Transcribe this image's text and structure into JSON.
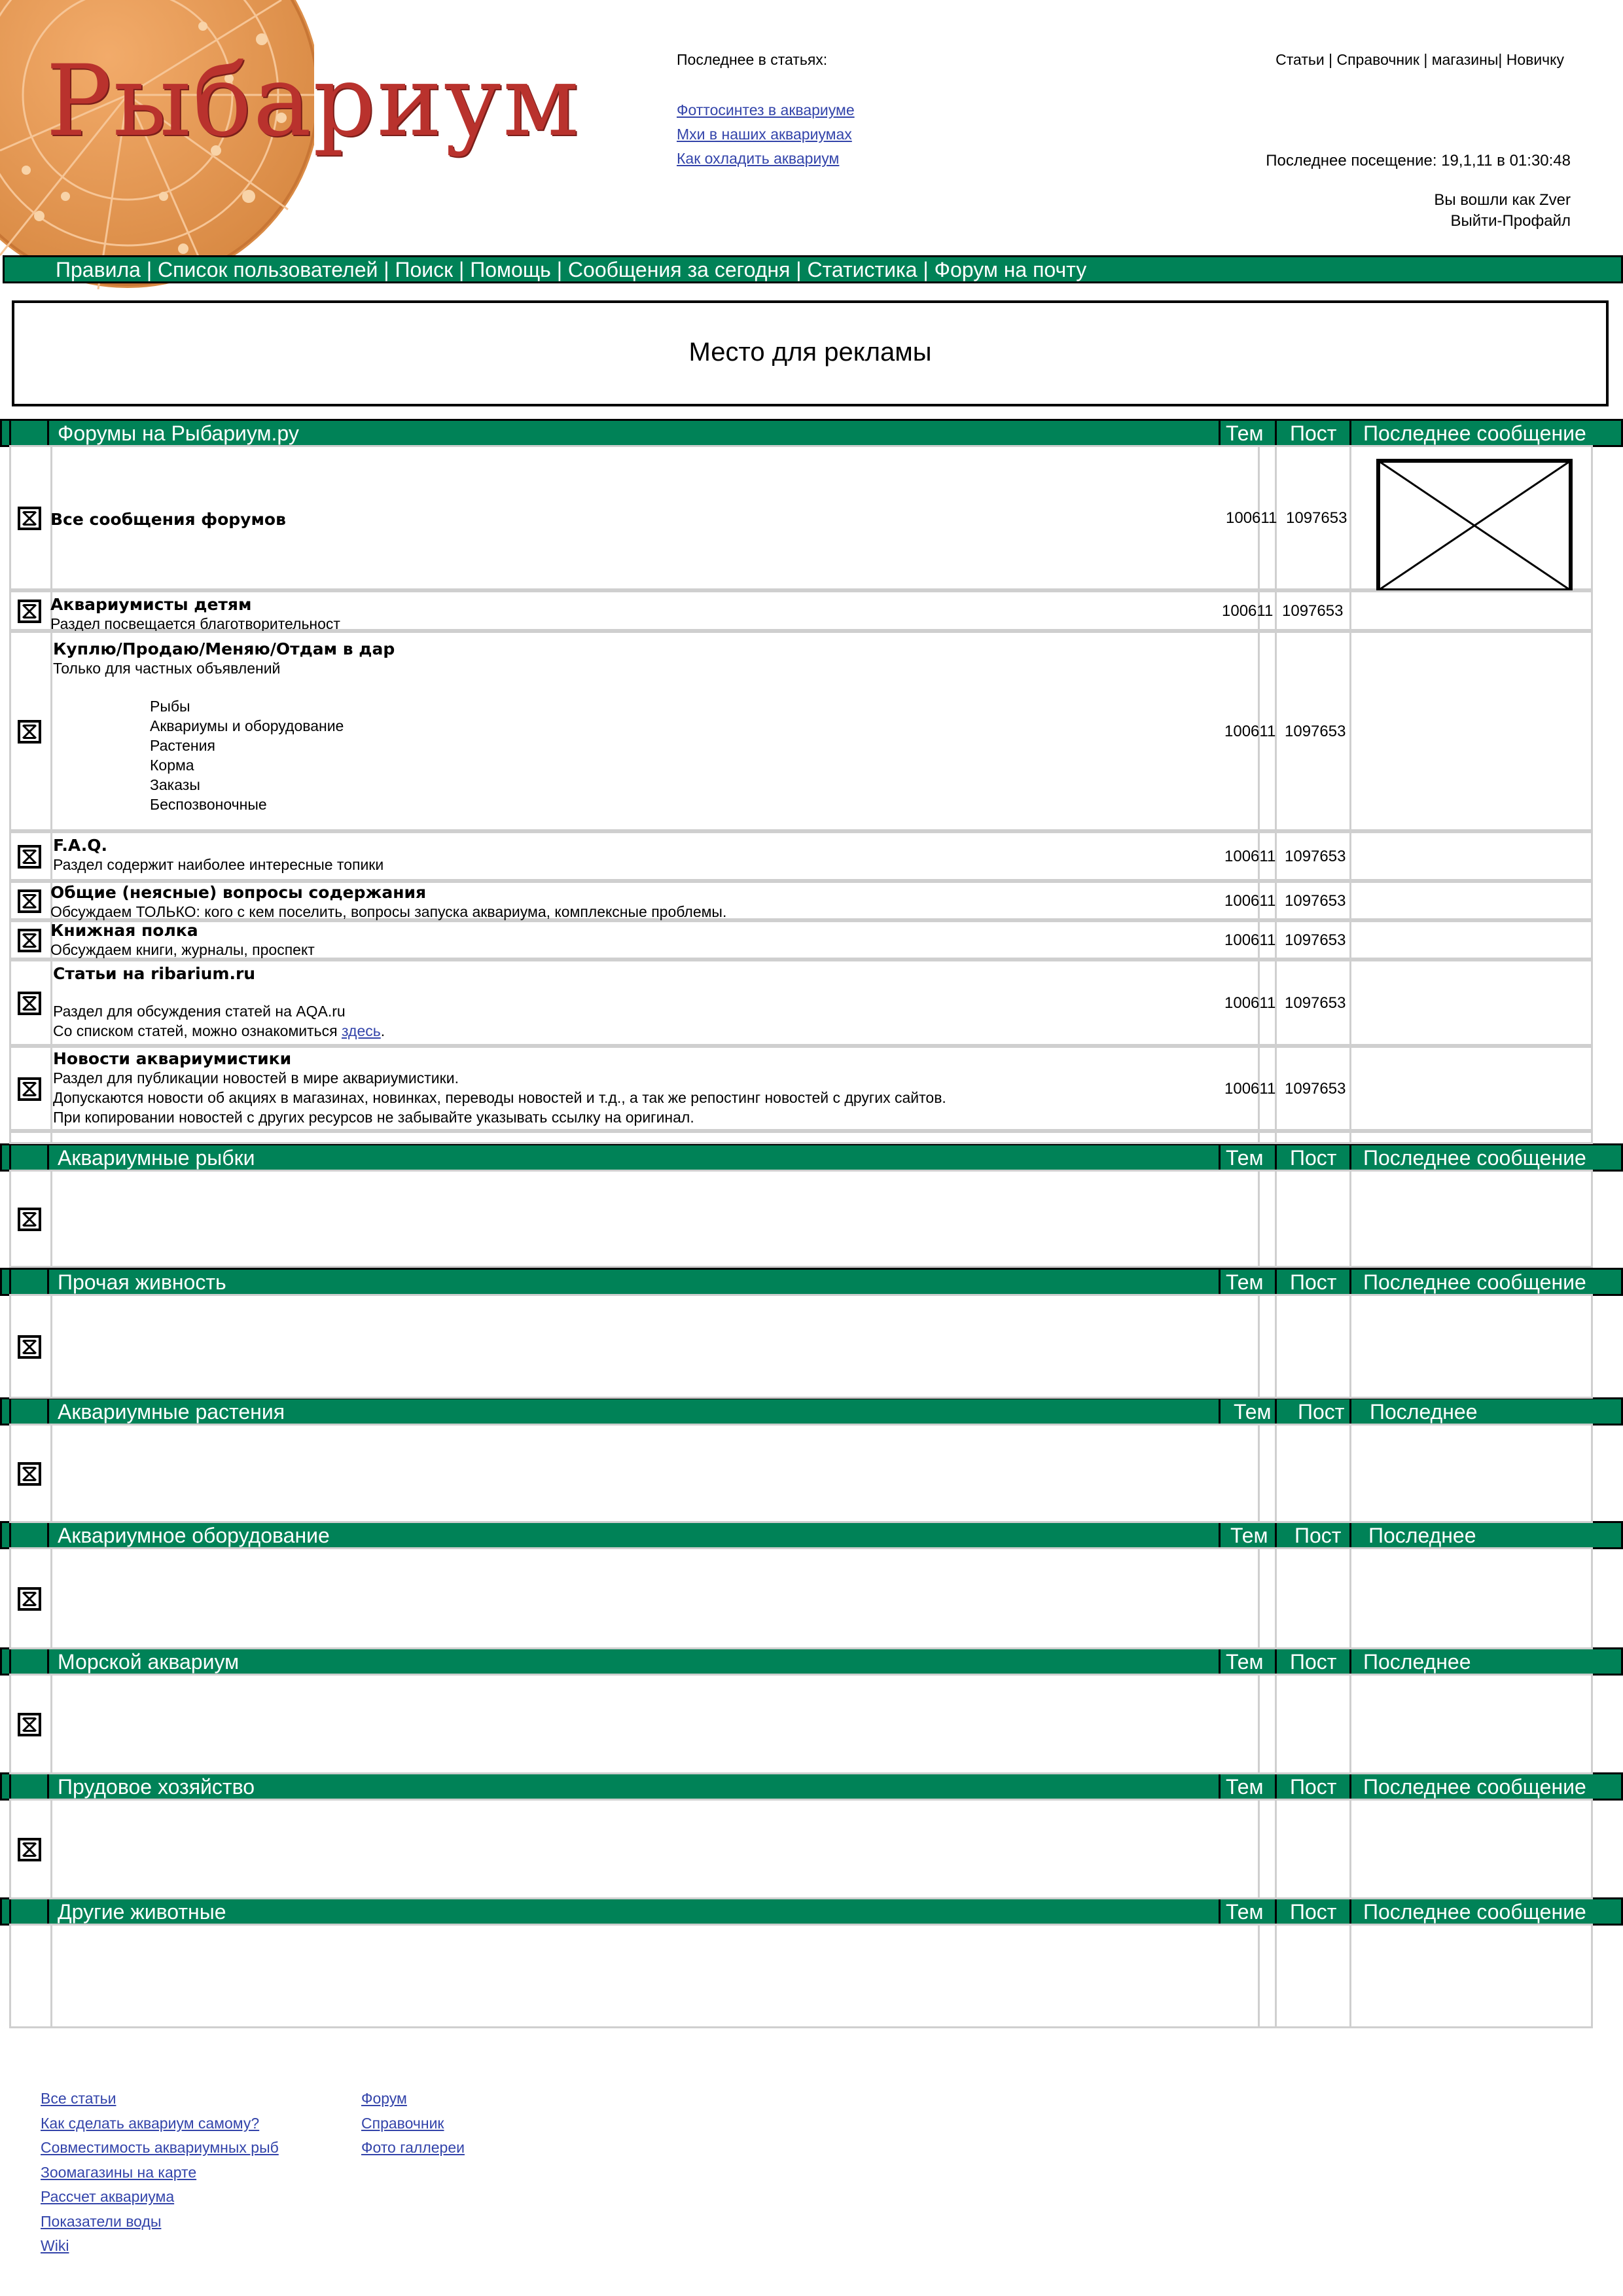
{
  "header": {
    "logo_text": "Рыбариум",
    "latest_heading": "Последнее в статьях:",
    "latest_articles": [
      "Фоттосинтез в аквариуме",
      "Мхи в наших аквариумах",
      "Как охладить аквариум"
    ],
    "top_nav": "Статьи | Справочник | магазины| Новичку",
    "last_visit": "Последнее посещение: 19,1,11 в 01:30:48",
    "logged_as": "Вы вошли как Zver",
    "logout_profile": "Выйти-Профайл"
  },
  "main_nav": "Правила | Список пользователей | Поиск | Помощь | Сообщения за сегодня | Статистика | Форум на почту",
  "ad_text": "Место для рекламы",
  "colors": {
    "bar_green": "#008257",
    "link": "#3344aa",
    "row_border": "#cfcfcf"
  },
  "sections": [
    {
      "title": "Форумы на Рыбариум.ру",
      "col_topics": "Тем",
      "col_posts": "Пост",
      "col_last": "Последнее сообщение"
    },
    {
      "title": "Аквариумные рыбки",
      "col_topics": "Тем",
      "col_posts": "Пост",
      "col_last": "Последнее сообщение"
    },
    {
      "title": "Прочая живность",
      "col_topics": "Тем",
      "col_posts": "Пост",
      "col_last": "Последнее сообщение"
    },
    {
      "title": "Аквариумные растения",
      "col_topics": "Тем",
      "col_posts": "Пост",
      "col_last": "Последнее"
    },
    {
      "title": "Аквариумное оборудование",
      "col_topics": "Тем",
      "col_posts": "Пост",
      "col_last": "Последнее"
    },
    {
      "title": "Морской аквариум",
      "col_topics": "Тем",
      "col_posts": "Пост",
      "col_last": "Последнее"
    },
    {
      "title": "Прудовое хозяйство",
      "col_topics": "Тем",
      "col_posts": "Пост",
      "col_last": "Последнее сообщение"
    },
    {
      "title": "Другие животные",
      "col_topics": "Тем",
      "col_posts": "Пост",
      "col_last": "Последнее сообщение"
    }
  ],
  "forums": [
    {
      "title": "Все сообщения форумов",
      "topics": "100611",
      "posts": "1097653"
    },
    {
      "title": "Аквариумисты детям",
      "desc": "Раздел  посвещается благотворительност",
      "topics": "100611",
      "posts": "1097653"
    },
    {
      "title": "Куплю/Продаю/Меняю/Отдам в дар",
      "desc": "Только для частных объявлений",
      "subforums": [
        "Рыбы",
        "Аквариумы и оборудование",
        "Растения",
        "Корма",
        "Заказы",
        "Беспозвоночные"
      ],
      "topics": "100611",
      "posts": "1097653"
    },
    {
      "title": "F.A.Q.",
      "desc": "Раздел содержит наиболее интересные топики",
      "topics": "100611",
      "posts": "1097653"
    },
    {
      "title": "Общие (неясные) вопросы содержания",
      "desc": "Обсуждаем ТОЛЬКО: кого с кем поселить, вопросы запуска аквариума, комплексные проблемы.",
      "topics": "100611",
      "posts": "1097653"
    },
    {
      "title": "Книжная полка",
      "desc": "Обсуждаем книги, журналы, проспект",
      "topics": "100611",
      "posts": "1097653"
    },
    {
      "title": "Статьи на ribarium.ru",
      "desc1": "Раздел для обсуждения статей на AQA.ru",
      "desc2": "Со списком статей, можно ознакомиться ",
      "desc2_link": "здесь",
      "topics": "100611",
      "posts": "1097653"
    },
    {
      "title": "Новости аквариумистики",
      "desc1": "Раздел для публикации новостей в мире аквариумистики.",
      "desc2": "Допускаются новости об акциях в магазинах, новинках, переводы новостей и т.д., а так же репостинг новостей с других сайтов.",
      "desc3": "При копировании новостей с других ресурсов не забывайте указывать ссылку на оригинал.",
      "topics": "100611",
      "posts": "1097653"
    }
  ],
  "footer": {
    "left_links": [
      "Все статьи",
      "Как сделать аквариум самому?",
      "Совместимость аквариумных рыб",
      "Зоомагазины на карте",
      "Рассчет аквариума",
      "Показатели воды",
      "Wiki"
    ],
    "right_links": [
      "Форум",
      "Справочник",
      "Фото галлереи"
    ]
  }
}
